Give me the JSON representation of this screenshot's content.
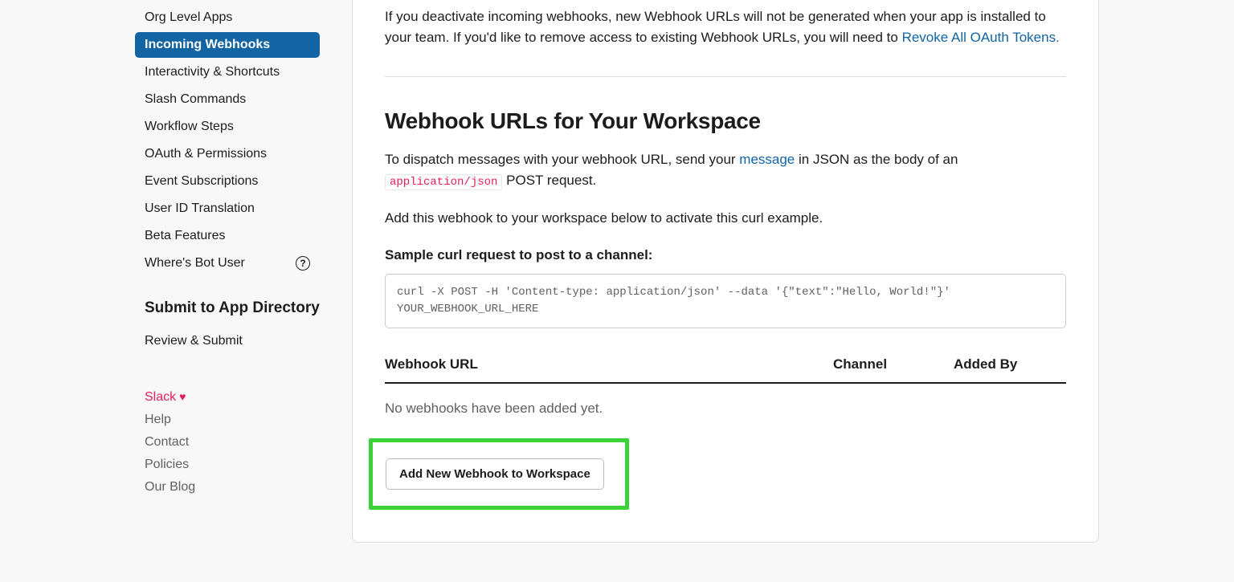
{
  "sidebar": {
    "items": [
      {
        "label": "Org Level Apps",
        "active": false
      },
      {
        "label": "Incoming Webhooks",
        "active": true
      },
      {
        "label": "Interactivity & Shortcuts",
        "active": false
      },
      {
        "label": "Slash Commands",
        "active": false
      },
      {
        "label": "Workflow Steps",
        "active": false
      },
      {
        "label": "OAuth & Permissions",
        "active": false
      },
      {
        "label": "Event Subscriptions",
        "active": false
      },
      {
        "label": "User ID Translation",
        "active": false
      },
      {
        "label": "Beta Features",
        "active": false
      },
      {
        "label": "Where's Bot User",
        "active": false,
        "help": true
      }
    ],
    "submit_heading": "Submit to App Directory",
    "review_submit": "Review & Submit",
    "footer": {
      "brand": "Slack",
      "help": "Help",
      "contact": "Contact",
      "policies": "Policies",
      "blog": "Our Blog"
    }
  },
  "main": {
    "intro_part1": "If you deactivate incoming webhooks, new Webhook URLs will not be generated when your app is installed to your team. If you'd like to remove access to existing Webhook URLs, you will need to ",
    "intro_link": "Revoke All OAuth Tokens.",
    "section_heading": "Webhook URLs for Your Workspace",
    "desc_part1": "To dispatch messages with your webhook URL, send your ",
    "desc_link": "message",
    "desc_part2": " in JSON as the body of an ",
    "desc_code": "application/json",
    "desc_part3": " POST request.",
    "desc2": "Add this webhook to your workspace below to activate this curl example.",
    "sample_label": "Sample curl request to post to a channel:",
    "code_block": "curl -X POST -H 'Content-type: application/json' --data '{\"text\":\"Hello, World!\"}' YOUR_WEBHOOK_URL_HERE",
    "table": {
      "col_url": "Webhook URL",
      "col_channel": "Channel",
      "col_added": "Added By",
      "empty": "No webhooks have been added yet."
    },
    "add_button": "Add New Webhook to Workspace"
  }
}
